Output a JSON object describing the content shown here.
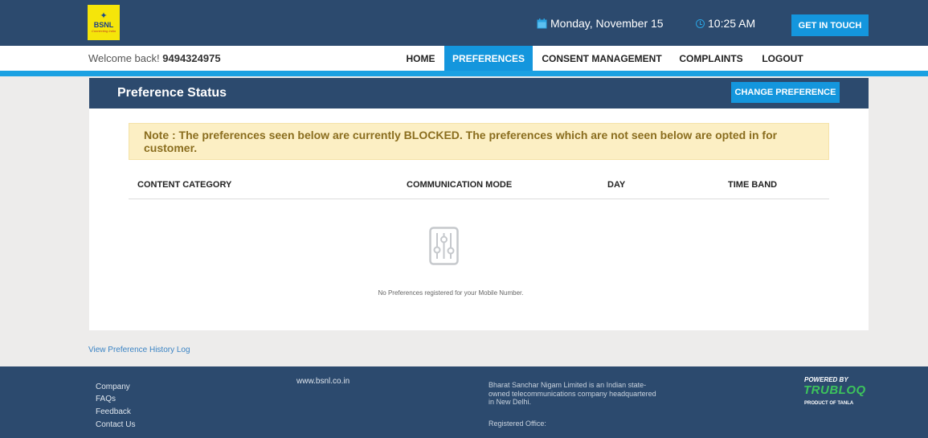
{
  "header": {
    "logo_text": "BSNL",
    "logo_tagline": "Connecting India",
    "date": "Monday, November 15",
    "time": "10:25 AM",
    "get_in_touch": "GET IN TOUCH"
  },
  "nav": {
    "welcome_prefix": "Welcome back! ",
    "mobile": "9494324975",
    "items": [
      {
        "label": "HOME",
        "active": false
      },
      {
        "label": "PREFERENCES",
        "active": true
      },
      {
        "label": "CONSENT MANAGEMENT",
        "active": false
      },
      {
        "label": "COMPLAINTS",
        "active": false
      },
      {
        "label": "LOGOUT",
        "active": false
      }
    ]
  },
  "card": {
    "title": "Preference Status",
    "change_button": "CHANGE PREFERENCE",
    "note": "Note : The preferences seen below are currently BLOCKED. The preferences which are not seen below are opted in for customer.",
    "columns": [
      "CONTENT CATEGORY",
      "COMMUNICATION MODE",
      "DAY",
      "TIME BAND"
    ],
    "empty_icon": "sliders-icon",
    "empty_message": "No Preferences registered for your Mobile Number."
  },
  "history_link": "View Preference History Log",
  "footer": {
    "links": [
      "Company",
      "FAQs",
      "Feedback",
      "Contact Us"
    ],
    "website": "www.bsnl.co.in",
    "about": "Bharat Sanchar Nigam Limited is an Indian state-owned telecommunications company headquartered in New Delhi.",
    "office_label": "Registered Office:",
    "powered_by": "POWERED BY",
    "brand": "TRUBLOQ",
    "brand_sub": "PRODUCT OF TANLA"
  },
  "colors": {
    "header_bg": "#2c4a6e",
    "accent": "#1496dd",
    "note_bg": "#fcefc4",
    "brand_green": "#3dc45c"
  }
}
